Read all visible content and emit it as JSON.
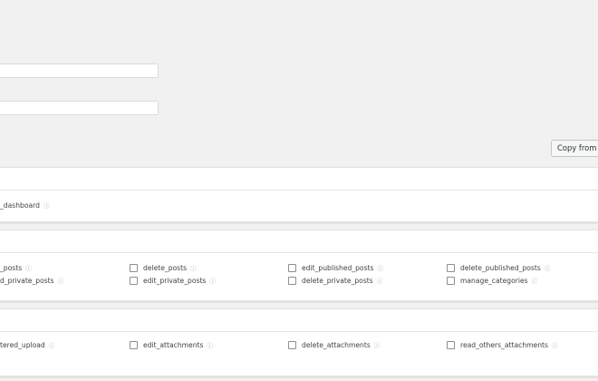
{
  "copy_button_label": "Copy from",
  "sections": [
    {
      "capabilities": [
        {
          "label": "_dashboard",
          "help_icon": "help-circle-icon"
        }
      ]
    },
    {
      "capabilities": [
        {
          "label": "_posts"
        },
        {
          "label": "delete_posts"
        },
        {
          "label": "edit_published_posts"
        },
        {
          "label": "delete_published_posts"
        },
        {
          "label": "d_private_posts"
        },
        {
          "label": "edit_private_posts"
        },
        {
          "label": "delete_private_posts"
        },
        {
          "label": "manage_categories"
        }
      ]
    },
    {
      "capabilities": [
        {
          "label": "tered_upload"
        },
        {
          "label": "edit_attachments"
        },
        {
          "label": "delete_attachments"
        },
        {
          "label": "read_others_attachments"
        }
      ]
    }
  ],
  "help_glyph": "ⓘ"
}
